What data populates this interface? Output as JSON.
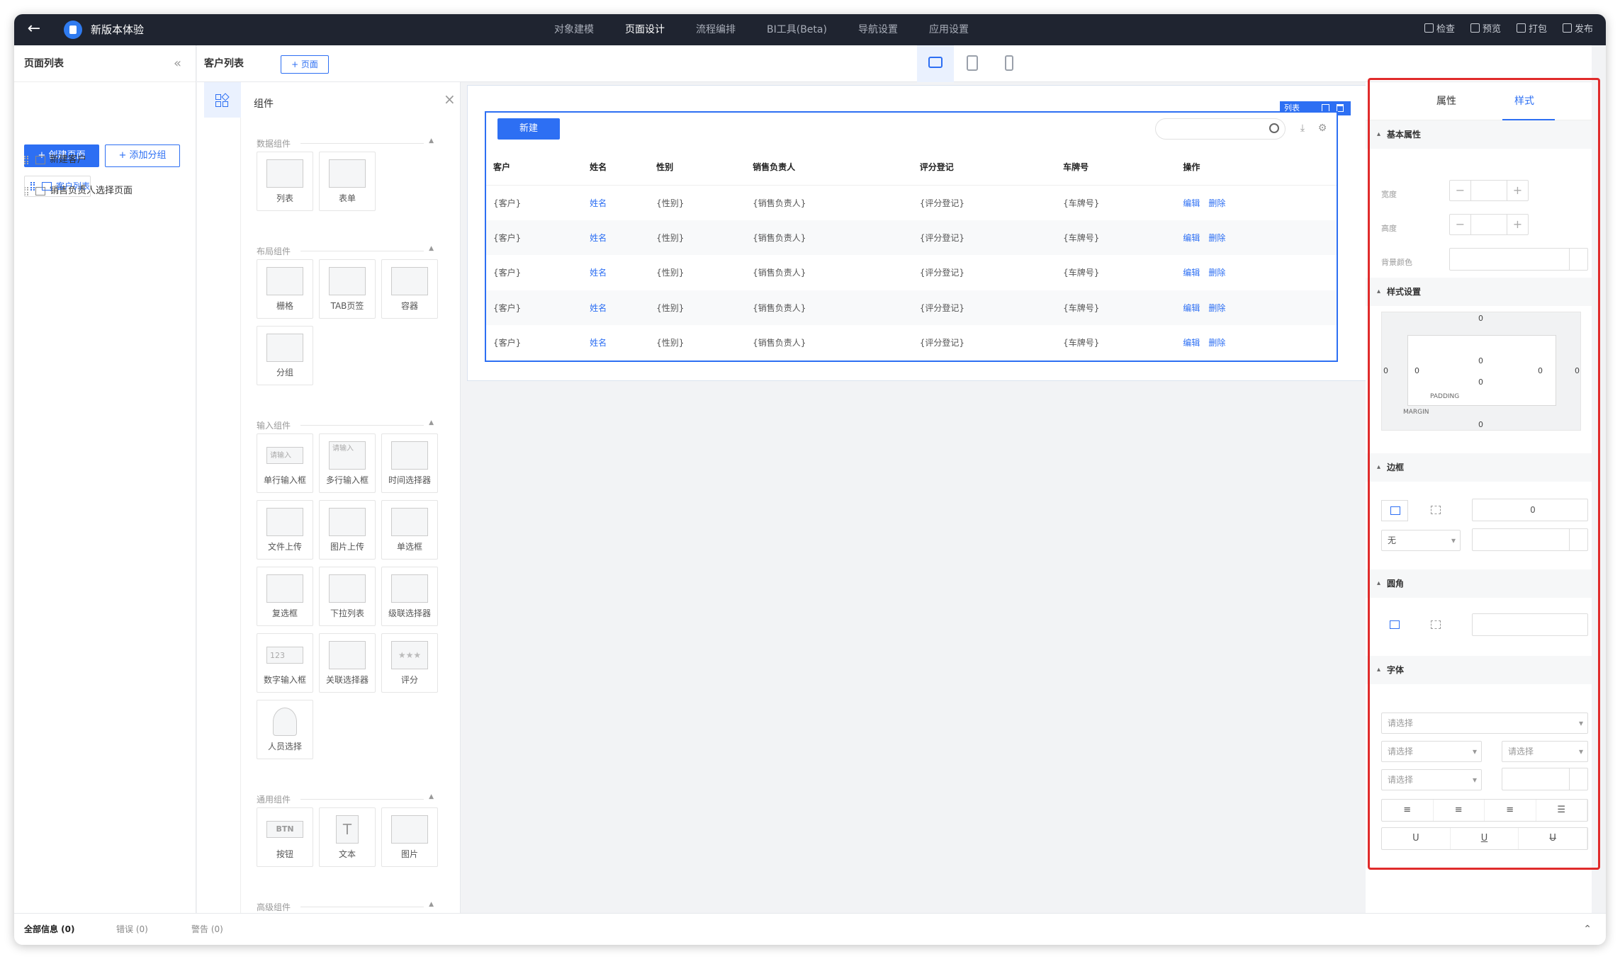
{
  "topbar": {
    "app_name": "新版本体验",
    "nav": [
      "对象建模",
      "页面设计",
      "流程编排",
      "BI工具(Beta)",
      "导航设置",
      "应用设置"
    ],
    "tools": [
      "检查",
      "预览",
      "打包",
      "发布"
    ]
  },
  "left": {
    "title": "页面列表",
    "create_page": "+ 创建页面",
    "add_group": "+ 添加分组",
    "pages": [
      "新建客户",
      "客户列表",
      "销售负责人选择页面"
    ]
  },
  "subbar": {
    "title": "客户列表",
    "add_page": "+ 页面"
  },
  "components": {
    "title": "组件",
    "sections": {
      "data": "数据组件",
      "layout": "布局组件",
      "input": "输入组件",
      "common": "通用组件",
      "advanced": "高级组件"
    },
    "data_items": [
      "列表",
      "表单"
    ],
    "layout_items": [
      "栅格",
      "TAB页签",
      "容器",
      "分组"
    ],
    "input_items": [
      "单行输入框",
      "多行输入框",
      "时间选择器",
      "文件上传",
      "图片上传",
      "单选框",
      "复选框",
      "下拉列表",
      "级联选择器",
      "数字输入框",
      "关联选择器",
      "评分",
      "人员选择"
    ],
    "common_items": [
      "按钮",
      "文本",
      "图片"
    ],
    "tile_texts": {
      "input_placeholder": "请输入",
      "number": "123",
      "btn": "BTN"
    }
  },
  "canvas": {
    "tag": "列表",
    "new_button": "新建",
    "columns": [
      "客户",
      "姓名",
      "性别",
      "销售负责人",
      "评分登记",
      "车牌号",
      "操作"
    ],
    "rows": [
      [
        "{客户}",
        "姓名",
        "{性别}",
        "{销售负责人}",
        "{评分登记}",
        "{车牌号}"
      ],
      [
        "{客户}",
        "姓名",
        "{性别}",
        "{销售负责人}",
        "{评分登记}",
        "{车牌号}"
      ],
      [
        "{客户}",
        "姓名",
        "{性别}",
        "{销售负责人}",
        "{评分登记}",
        "{车牌号}"
      ],
      [
        "{客户}",
        "姓名",
        "{性别}",
        "{销售负责人}",
        "{评分登记}",
        "{车牌号}"
      ],
      [
        "{客户}",
        "姓名",
        "{性别}",
        "{销售负责人}",
        "{评分登记}",
        "{车牌号}"
      ]
    ],
    "actions": [
      "编辑",
      "删除"
    ]
  },
  "props": {
    "tabs": [
      "属性",
      "样式"
    ],
    "active_tab": "样式",
    "basic": "基本属性",
    "width_label": "宽度",
    "height_label": "高度",
    "bg_label": "背景颜色",
    "style_settings": "样式设置",
    "box": {
      "top": "0",
      "p_top": "0",
      "p_bottom": "0",
      "bottom": "0",
      "left": "0",
      "p_left": "0",
      "p_right": "0",
      "right": "0",
      "padding": "PADDING",
      "margin": "MARGIN"
    },
    "border": "边框",
    "border_width": "0",
    "border_style": "无",
    "radius": "圆角",
    "font": "字体",
    "placeholder": "请选择"
  },
  "bottom": {
    "all": "全部信息 (0)",
    "error": "错误 (0)",
    "warn": "警告 (0)"
  },
  "colors": {
    "accent": "#2d6ff3",
    "topbar": "#1f2430",
    "highlight": "#e02b2b"
  }
}
